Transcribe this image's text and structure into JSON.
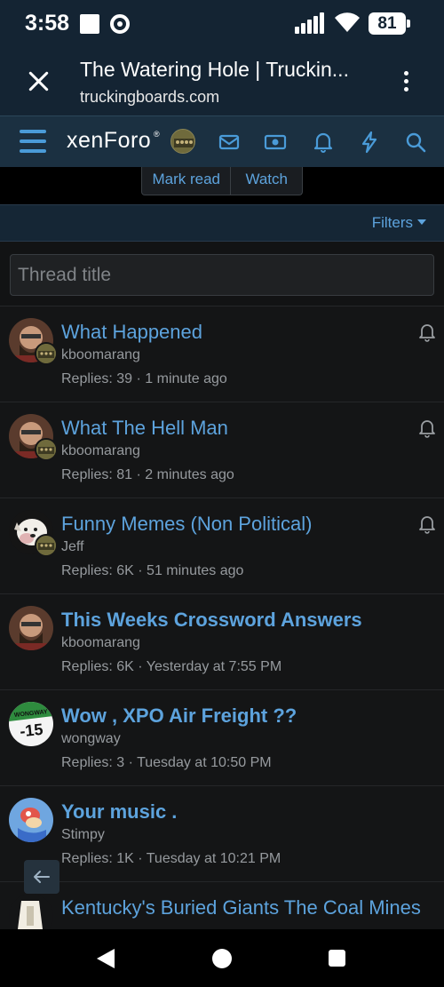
{
  "status_bar": {
    "time": "3:58",
    "battery": "81"
  },
  "browser": {
    "title": "The Watering Hole | Truckin...",
    "url": "truckingboards.com"
  },
  "site": {
    "logo": "xenForo",
    "logo_mark": "®"
  },
  "actions": {
    "mark_read": "Mark read",
    "watch": "Watch"
  },
  "filters": {
    "label": "Filters"
  },
  "search": {
    "placeholder": "Thread title"
  },
  "threads": [
    {
      "title": "What Happened",
      "author": "kboomarang",
      "meta": "Replies: 39 · 1 minute ago",
      "bold": false,
      "watched": true
    },
    {
      "title": "What The Hell Man",
      "author": "kboomarang",
      "meta": "Replies: 81 · 2 minutes ago",
      "bold": false,
      "watched": true
    },
    {
      "title": "Funny Memes (Non Political)",
      "author": "Jeff",
      "meta": "Replies: 6K · 51 minutes ago",
      "bold": false,
      "watched": true
    },
    {
      "title": "This Weeks Crossword Answers",
      "author": "kboomarang",
      "meta": "Replies: 6K · Yesterday at 7:55 PM",
      "bold": true,
      "watched": false
    },
    {
      "title": "Wow , XPO Air Freight ??",
      "author": "wongway",
      "meta": "Replies: 3 · Tuesday at 10:50 PM",
      "bold": true,
      "watched": false
    },
    {
      "title": "Your music .",
      "author": "Stimpy",
      "meta": "Replies: 1K · Tuesday at 10:21 PM",
      "bold": true,
      "watched": false
    },
    {
      "title": "Kentucky's Buried Giants The Coal Mines",
      "author": "",
      "meta": "",
      "bold": false,
      "watched": false
    }
  ],
  "avatar_labels": {
    "wongway": "WONGWAY",
    "wongway_number": "-15"
  }
}
